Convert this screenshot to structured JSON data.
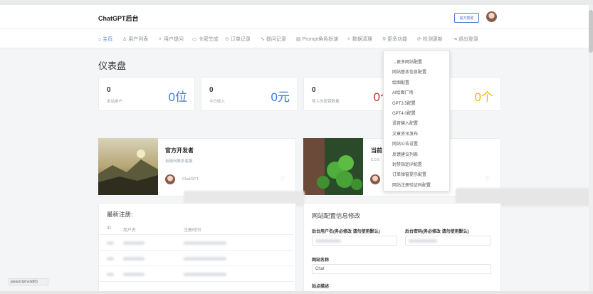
{
  "app": {
    "brand": "ChatGPT后台",
    "official_button": "官方帮助"
  },
  "nav": [
    {
      "label": "主页",
      "icon": "⌂",
      "icon_name": "home-icon",
      "active": true
    },
    {
      "label": "用户列表",
      "icon": "♙",
      "icon_name": "user-icon"
    },
    {
      "label": "用户提问",
      "icon": "✧",
      "icon_name": "question-icon"
    },
    {
      "label": "卡密生成",
      "icon": "▭",
      "icon_name": "card-icon"
    },
    {
      "label": "订单记录",
      "icon": "⊙",
      "icon_name": "order-icon"
    },
    {
      "label": "提问记录",
      "icon": "∿",
      "icon_name": "record-icon"
    },
    {
      "label": "Prompt角色扮演",
      "icon": "▤",
      "icon_name": "prompt-icon"
    },
    {
      "label": "数据清理",
      "icon": "✧",
      "icon_name": "clean-icon"
    },
    {
      "label": "更多功能",
      "icon": "⚲",
      "icon_name": "more-icon"
    },
    {
      "label": "检测更新",
      "icon": "⟳",
      "icon_name": "update-icon"
    },
    {
      "label": "退出登录",
      "icon": "⇥",
      "icon_name": "logout-icon"
    }
  ],
  "page_title": "仪表盘",
  "stats": [
    {
      "num": "0",
      "label": "本站用户",
      "value": "0位",
      "color": "#3a7bd5"
    },
    {
      "num": "0",
      "label": "今日收入",
      "value": "0元",
      "color": "#3a7bd5"
    },
    {
      "num": "0",
      "label": "导入的密钥数量",
      "value": "0个",
      "color": "#c0392b"
    },
    {
      "value": "0个",
      "color": "#f5b800"
    }
  ],
  "profile1": {
    "title": "官方开发者",
    "sub": "有疑问联系客服",
    "author": "ChatGPT"
  },
  "profile2": {
    "title": "当前",
    "sub": "5.0.6"
  },
  "recent": {
    "title": "最新注册:",
    "cols": [
      "ID",
      "用户名",
      "注册时间"
    ]
  },
  "settings": {
    "title": "网站配置信息修改",
    "admin_user_label": "后台用户名(务必修改 请勿使用默认)",
    "admin_pass_label": "后台密码(务必修改 请勿使用默认)",
    "site_name_label": "网站名称",
    "site_name_value": "Chat",
    "site_desc_label": "站点描述"
  },
  "dropdown": [
    "→更多网站配置",
    "网站基本信息配置",
    "绘图配置",
    "AI绘图广场",
    "GPT3.5配置",
    "GPT4.0配置",
    "语音输入配置",
    "文章资讯发布",
    "网站公告设置",
    "反馈建议列表",
    "封禁指定IP配置",
    "订单弹窗提示配置",
    "网站注册验证码配置"
  ],
  "status_bar": "javascript:void(0)"
}
